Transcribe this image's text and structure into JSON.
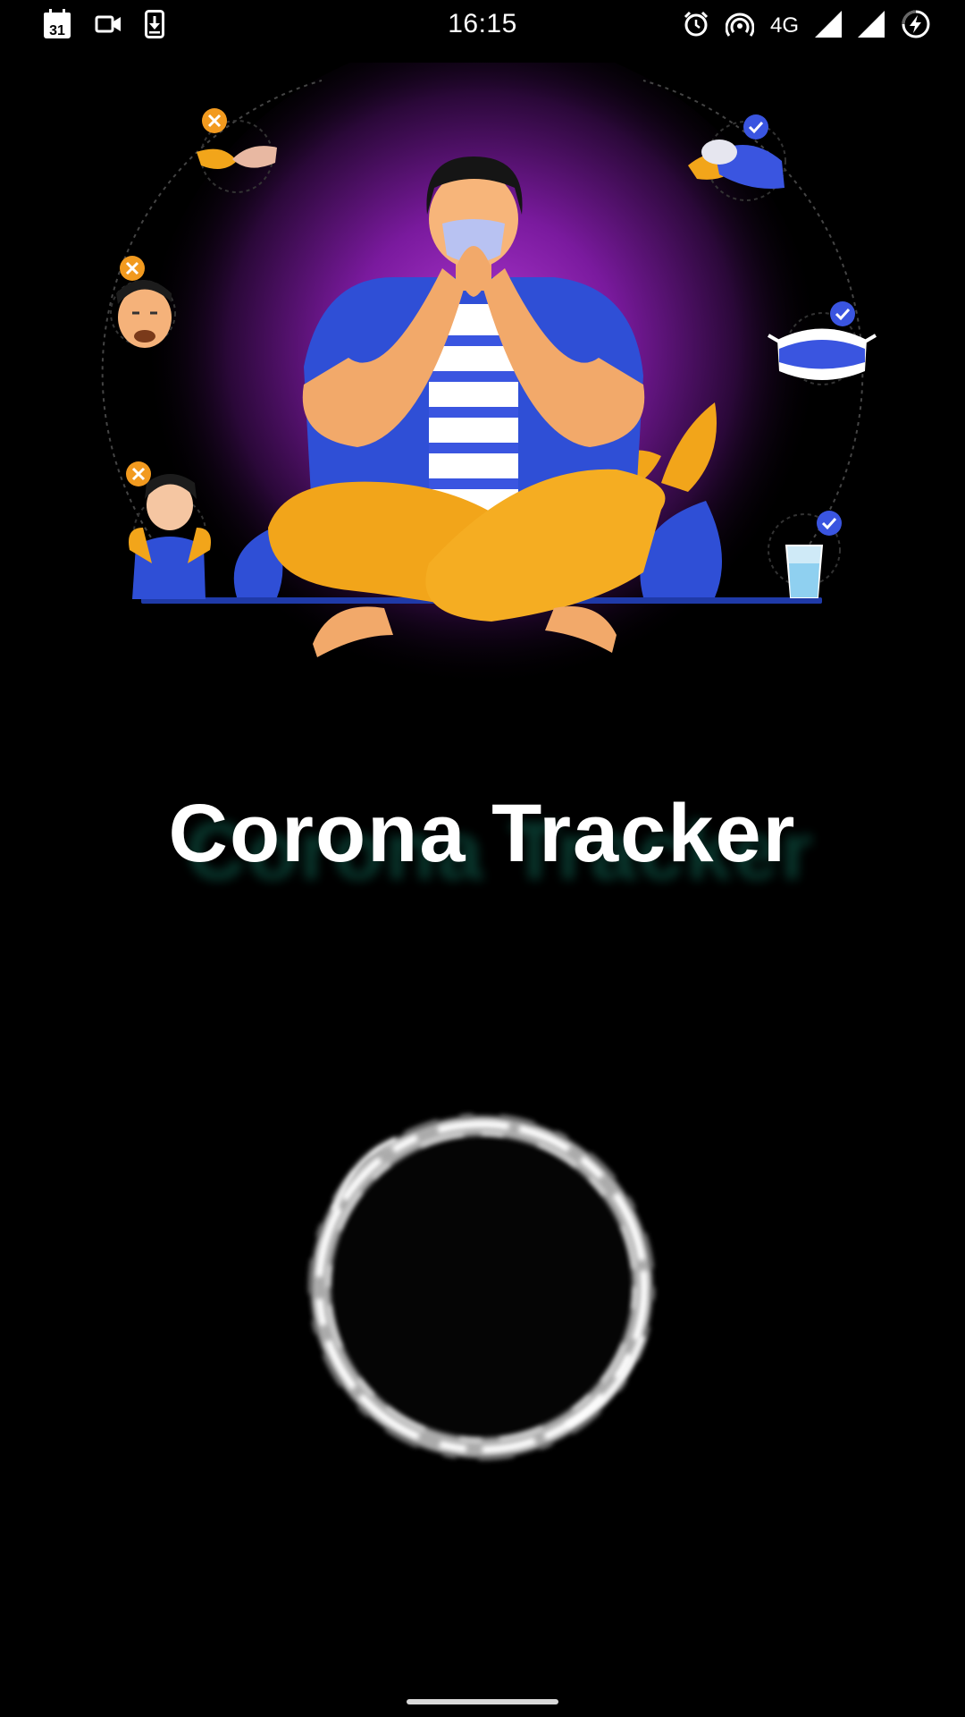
{
  "status_bar": {
    "time": "16:15",
    "calendar_day": "31",
    "network": "4G",
    "icons": [
      "calendar-icon",
      "video-camera-icon",
      "download-icon",
      "alarm-icon",
      "hotspot-icon",
      "signal-icon",
      "signal-icon",
      "battery-charging-icon"
    ]
  },
  "splash": {
    "title": "Corona Tracker",
    "colors": {
      "background": "#000000",
      "glow": "#8a1fb0",
      "shirt": "#2f4fd6",
      "pants": "#f2a51a",
      "badge_no": "#f29a1f",
      "badge_yes": "#3a55e0",
      "title_shadow": "#0f5a4a"
    }
  }
}
